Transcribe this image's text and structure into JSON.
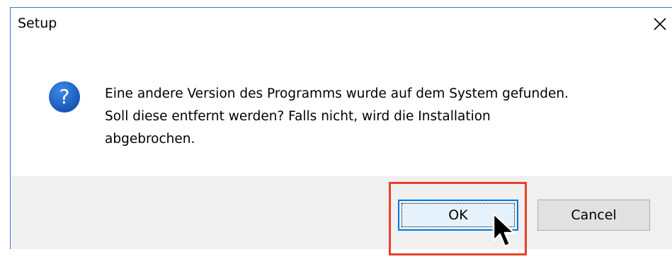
{
  "window": {
    "title": "Setup",
    "close_icon": "close-icon"
  },
  "message": {
    "icon": "question-icon",
    "icon_glyph": "?",
    "icon_color": "#1f65c4",
    "lines": [
      "Eine andere Version des Programms wurde auf dem System gefunden.",
      "Soll diese entfernt werden? Falls nicht, wird die Installation",
      "abgebrochen."
    ]
  },
  "buttons": {
    "ok_label": "OK",
    "cancel_label": "Cancel"
  },
  "annotation": {
    "highlight_color": "#e8412b",
    "target": "OK",
    "cursor_icon": "mouse-pointer-icon"
  }
}
